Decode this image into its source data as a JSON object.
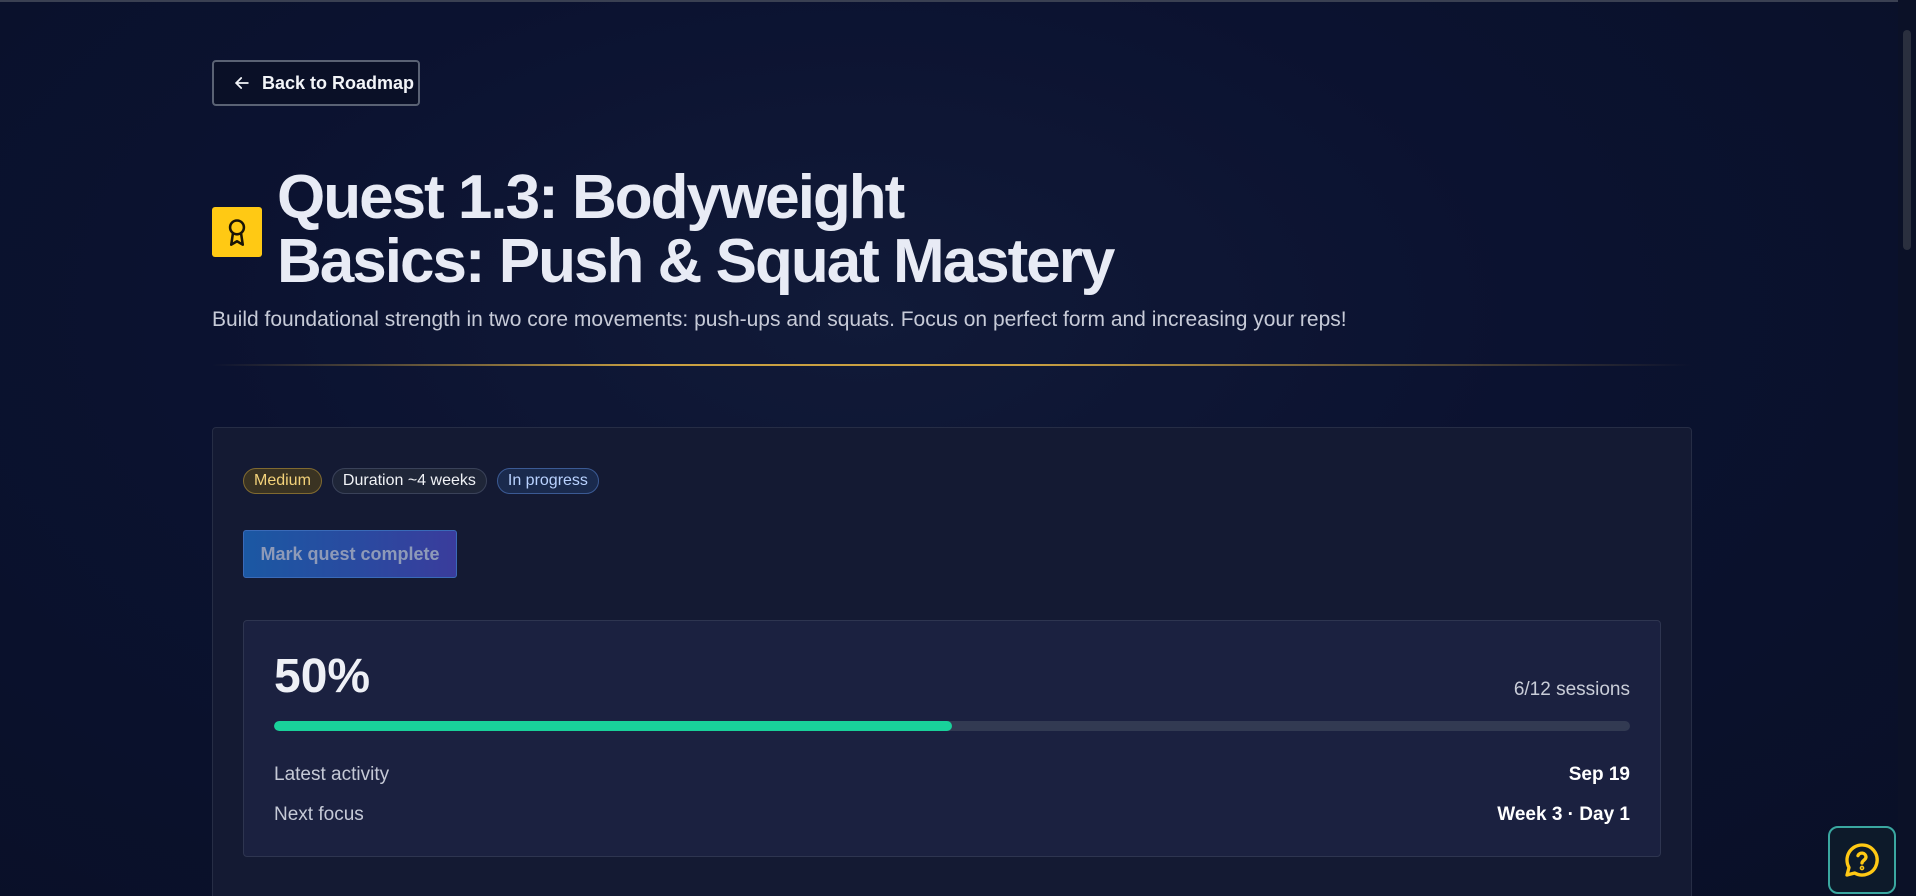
{
  "nav": {
    "back_label": "Back to Roadmap"
  },
  "quest": {
    "title_line1": "Quest 1.3: Bodyweight",
    "title_line2": "Basics: Push & Squat Mastery",
    "description": "Build foundational strength in two core movements: push-ups and squats. Focus on perfect form and increasing your reps!"
  },
  "badges": {
    "difficulty": "Medium",
    "duration": "Duration ~4 weeks",
    "status": "In progress"
  },
  "actions": {
    "complete_label": "Mark quest complete"
  },
  "progress": {
    "percent_text": "50%",
    "fraction": 0.5,
    "sessions_text": "6/12 sessions",
    "latest_activity_label": "Latest activity",
    "latest_activity_value": "Sep 19",
    "next_focus_label": "Next focus",
    "next_focus_value": "Week 3 · Day 1"
  },
  "colors": {
    "accent_yellow": "#ffc914",
    "progress_green": "#19d19a",
    "background": "#0b1127"
  },
  "icons": {
    "back": "arrow-left-icon",
    "quest": "award-ribbon-icon",
    "help": "help-chat-icon"
  }
}
